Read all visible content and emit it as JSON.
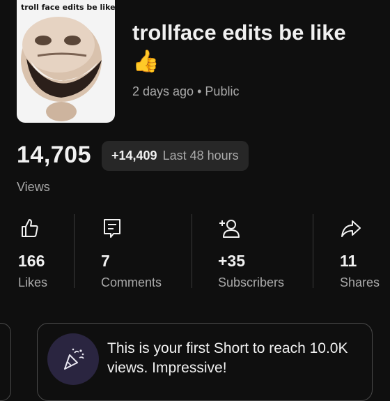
{
  "video": {
    "thumbnail_caption": "troll face edits be like",
    "title": "trollface edits be like👍",
    "age": "2 days ago",
    "separator": "•",
    "visibility": "Public"
  },
  "views": {
    "count": "14,705",
    "delta": "+14,409",
    "delta_period": "Last 48 hours",
    "label": "Views"
  },
  "stats": {
    "likes": {
      "icon": "thumbs-up-icon",
      "value": "166",
      "label": "Likes"
    },
    "comments": {
      "icon": "comment-icon",
      "value": "7",
      "label": "Comments"
    },
    "subscribers": {
      "icon": "add-person-icon",
      "value": "+35",
      "label": "Subscribers"
    },
    "shares": {
      "icon": "share-arrow-icon",
      "value": "11",
      "label": "Shares"
    }
  },
  "milestone": {
    "icon": "party-popper-icon",
    "text": "This is your first Short to reach 10.0K views. Impressive!"
  },
  "colors": {
    "background": "#0f0f0f",
    "chip": "#272727",
    "secondary_text": "#aaaaaa",
    "badge": "#2a2540"
  }
}
